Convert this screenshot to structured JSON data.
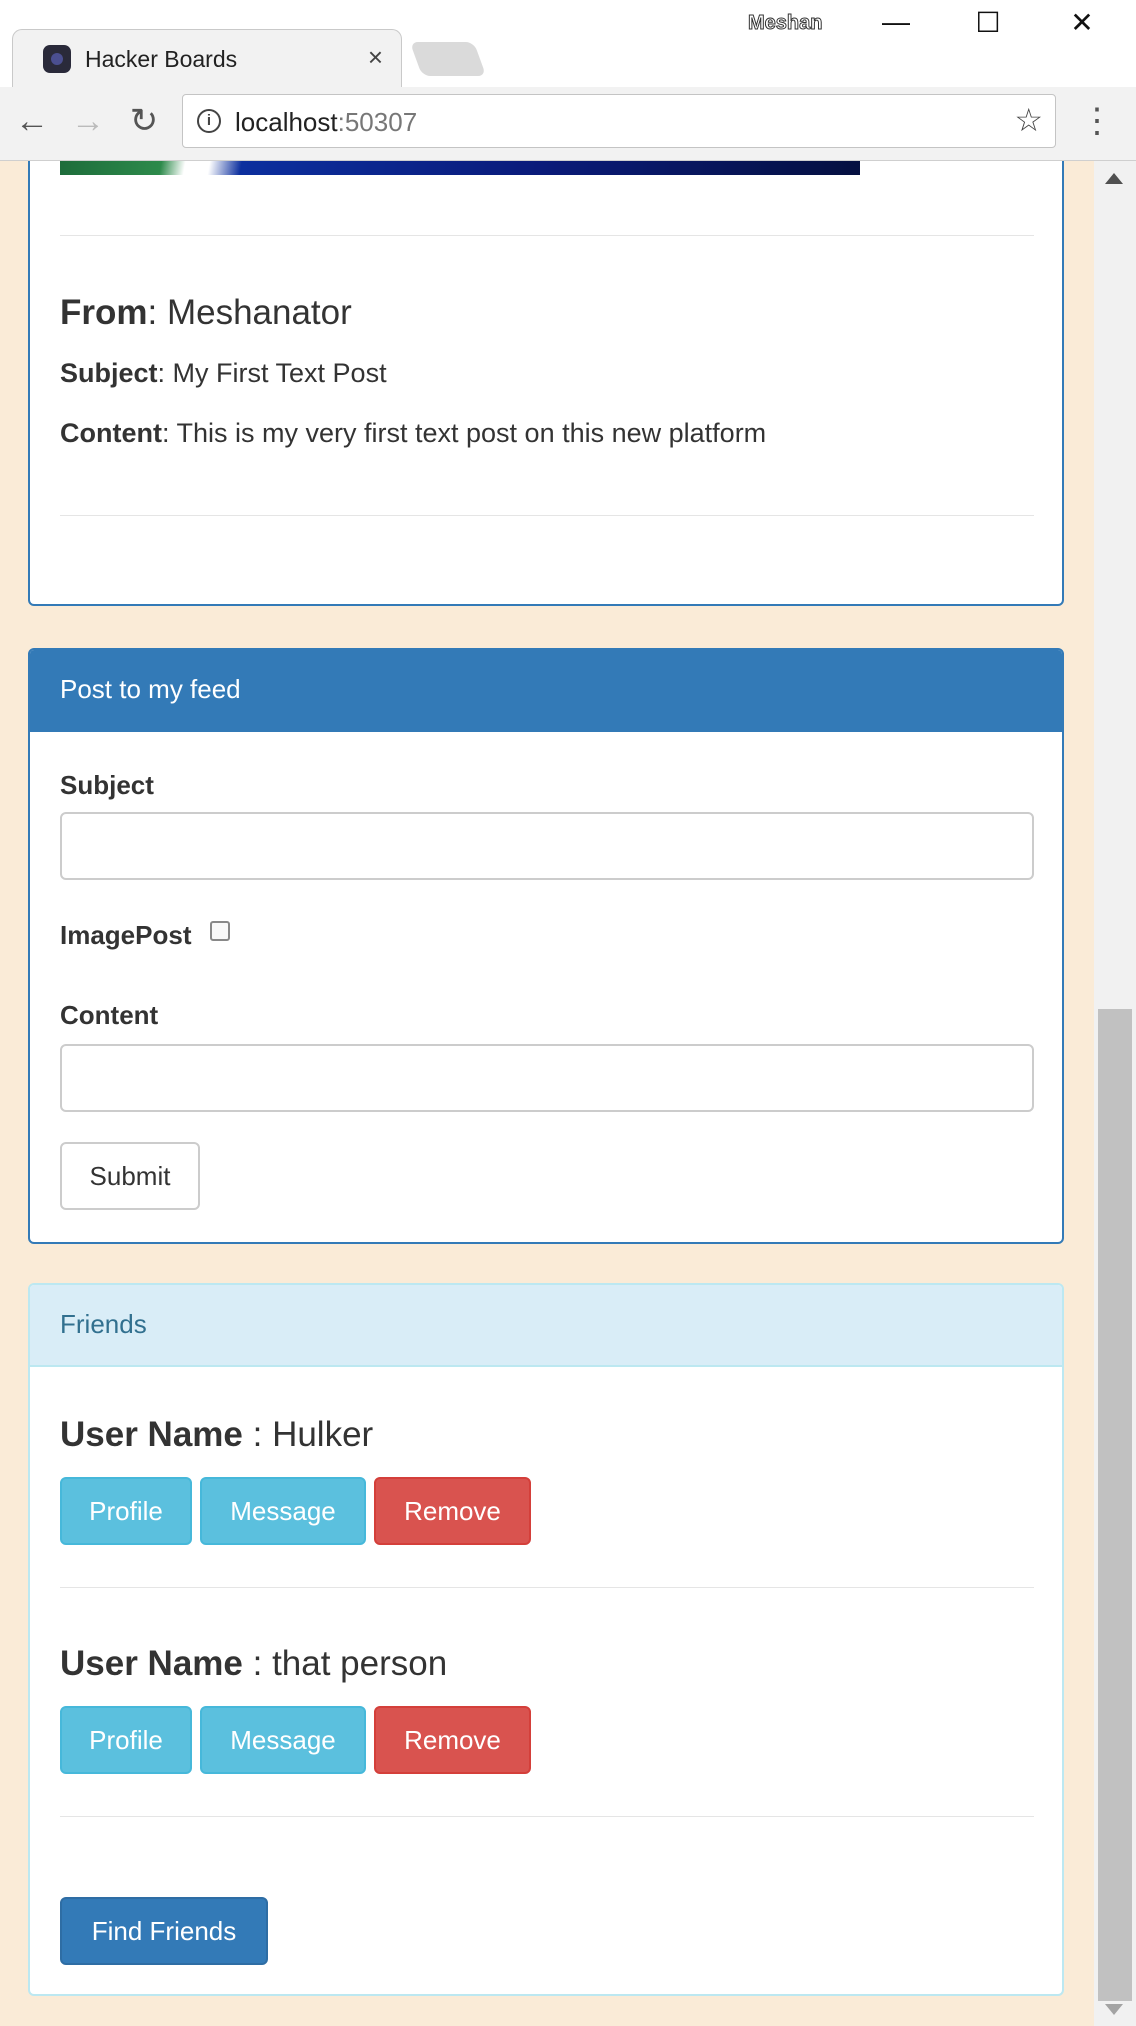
{
  "browser": {
    "tab_title": "Hacker Boards",
    "tab_close": "×",
    "profile_name": "Meshan",
    "url_host": "localhost",
    "url_port": ":50307",
    "window_controls": {
      "minimize": "—",
      "maximize": "☐",
      "close": "✕"
    },
    "nav_icons": {
      "back": "←",
      "forward": "→",
      "reload": "↻",
      "info": "i",
      "star": "☆",
      "menu": "⋮"
    }
  },
  "post": {
    "from_label": "From",
    "from_value": ": Meshanator",
    "subject_label": "Subject",
    "subject_value": ": My First Text Post",
    "content_label": "Content",
    "content_value": ": This is my very first text post on this new platform"
  },
  "post_form": {
    "heading": "Post to my feed",
    "subject_label": "Subject",
    "subject_value": "",
    "imagepost_label": "ImagePost",
    "imagepost_checked": false,
    "content_label": "Content",
    "content_value": "",
    "submit_label": "Submit"
  },
  "friends": {
    "heading": "Friends",
    "user_name_label": "User Name",
    "items": [
      {
        "name": " : Hulker",
        "profile_label": "Profile",
        "message_label": "Message",
        "remove_label": "Remove"
      },
      {
        "name": " : that person",
        "profile_label": "Profile",
        "message_label": "Message",
        "remove_label": "Remove"
      }
    ],
    "find_friends_label": "Find Friends"
  },
  "colors": {
    "page_background": "#faebd7",
    "primary": "#337ab7",
    "info": "#5bc0de",
    "danger": "#d9534f",
    "info_panel_heading": "#d9edf7"
  }
}
